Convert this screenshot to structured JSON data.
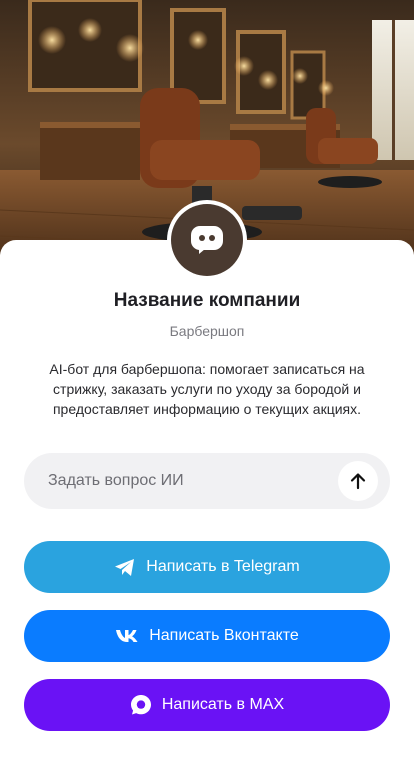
{
  "hero": {
    "image_icon": "barbershop-interior-image"
  },
  "profile": {
    "avatar_icon": "chat-bubble-icon",
    "name": "Название компании",
    "category": "Барбершоп",
    "description": "AI-бот для барбершопа: помогает записаться на стрижку, заказать услуги по уходу за бородой и предоставляет информацию о текущих акциях."
  },
  "ask": {
    "placeholder": "Задать вопрос ИИ",
    "send_icon": "arrow-up-icon"
  },
  "actions": {
    "telegram": {
      "label": "Написать в Telegram",
      "icon": "telegram-icon",
      "color": "#2aa3df"
    },
    "vk": {
      "label": "Написать Вконтакте",
      "icon": "vk-icon",
      "color": "#0a7cff"
    },
    "max": {
      "label": "Написать в MAX",
      "icon": "max-icon",
      "color": "#6a12f5"
    }
  }
}
